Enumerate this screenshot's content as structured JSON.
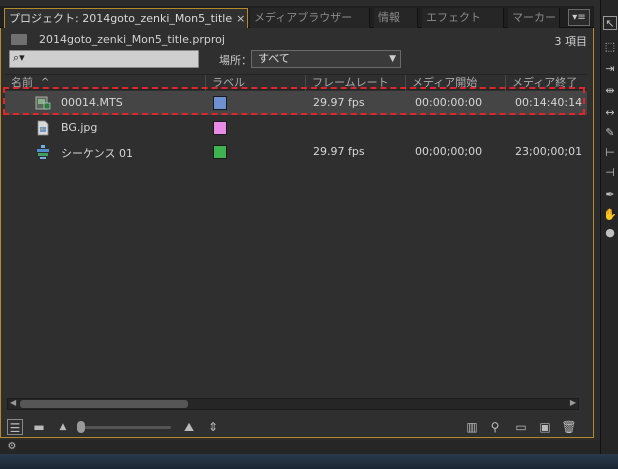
{
  "tabs": [
    {
      "label": "プロジェクト: 2014goto_zenki_Mon5_title",
      "close": "×",
      "active": true
    },
    {
      "label": "メディアブラウザー",
      "active": false
    },
    {
      "label": "情報",
      "active": false
    },
    {
      "label": "エフェクト",
      "active": false
    },
    {
      "label": "マーカー",
      "active": false
    }
  ],
  "tab_menu": "▾≡",
  "project": {
    "file_name": "2014goto_zenki_Mon5_title.prproj",
    "item_count": "3 項目"
  },
  "search": {
    "icon_text": "⌕▾",
    "value": ""
  },
  "location": {
    "label": "場所：",
    "value": "すべて"
  },
  "columns": {
    "name": "名前",
    "label": "ラベル",
    "frame_rate": "フレームレート",
    "media_start": "メディア開始",
    "media_end": "メディア終了"
  },
  "rows": [
    {
      "name": "00014.MTS",
      "label_color": "#6e8fd0",
      "frame_rate": "29.97 fps",
      "media_start": "00:00:00:00",
      "media_end": "00:14:40:14",
      "icon": "video-clip-icon",
      "selected": true
    },
    {
      "name": "BG.jpg",
      "label_color": "#e88ae8",
      "frame_rate": "",
      "media_start": "",
      "media_end": "",
      "icon": "image-file-icon",
      "selected": false
    },
    {
      "name": "シーケンス 01",
      "label_color": "#3fb34f",
      "frame_rate": "29.97 fps",
      "media_start": "00;00;00;00",
      "media_end": "23;00;00;01",
      "icon": "sequence-icon",
      "selected": false
    }
  ],
  "colors": {
    "panel_border": "#b58a2a",
    "highlight": "#e0262b",
    "selected_row": "#454545"
  }
}
